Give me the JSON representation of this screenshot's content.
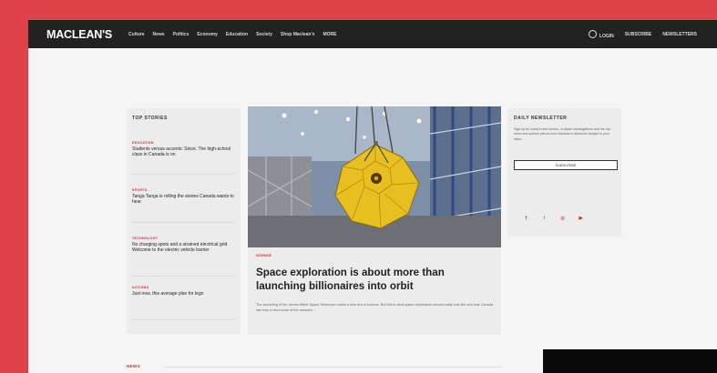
{
  "nav": {
    "logo": "MACLEAN'S",
    "items": [
      "Culture",
      "News",
      "Politics",
      "Economy",
      "Education",
      "Society",
      "Shop Maclean's",
      "MORE"
    ],
    "login": "LOGIN",
    "subscribe": "SUBSCRIBE",
    "newsletters": "NEWSLETTERS"
  },
  "top_stories": {
    "title": "TOP STORIES",
    "items": [
      {
        "category": "EDUCATION",
        "headline": "Students versus accents: Since. The high-school class in Canada is on"
      },
      {
        "category": "SPORTS",
        "headline": "Tanga Tanga is rolling the stories Canada wants to hear"
      },
      {
        "category": "TECHNOLOGY",
        "headline": "No charging spots and a strained electrical grid. Welcome to the electric vehicle barrier"
      },
      {
        "category": "ACTIONS",
        "headline": "Just now, this average plan for lego"
      }
    ]
  },
  "featured": {
    "category": "SCIENCE",
    "title": "Space exploration is about more than launching billionaires into orbit",
    "summary": "The launching of the James Webb Space Telescope marks a new era of science. But this is what space exploration should really look like and how Canada can help to find some of the answers. ›"
  },
  "newsletter": {
    "title": "DAILY NEWSLETTER",
    "description": "Sign up for today's best stories, in-depth investigations and the top news and opinion pieces from Maclean's delivered straight to your inbox",
    "button": "SUBSCRIBE"
  },
  "social": [
    {
      "icon": "facebook-icon",
      "glyph": "f",
      "color": "#3b5998"
    },
    {
      "icon": "twitter-icon",
      "glyph": "t",
      "color": "#1da1f2"
    },
    {
      "icon": "instagram-icon",
      "glyph": "◎",
      "color": "#c13584"
    },
    {
      "icon": "youtube-icon",
      "glyph": "▶",
      "color": "#ff0000"
    }
  ],
  "sections": {
    "news_label": "NEWS"
  },
  "colors": {
    "accent": "#d2273a",
    "page_bg": "#e0414b",
    "nav_bg": "#222222"
  }
}
